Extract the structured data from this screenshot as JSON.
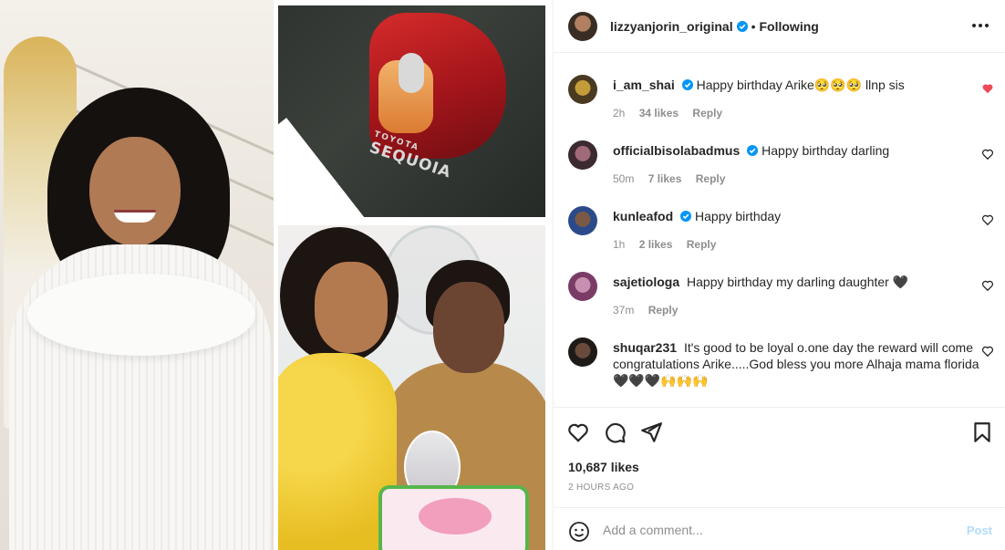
{
  "post": {
    "media_description": "collage-photo",
    "car_badge_brand": "TOYOTA",
    "car_badge_model": "SEQUOIA"
  },
  "header": {
    "username": "lizzyanjorin_original",
    "verified": true,
    "dot": "•",
    "follow_status": "Following",
    "more_icon": "more-horizontal-icon"
  },
  "comments": [
    {
      "username": "i_am_shai",
      "verified": true,
      "text": "Happy birthday Arike🥺🥺🥺 llnp sis",
      "time": "2h",
      "likes": "34 likes",
      "reply": "Reply",
      "liked": true
    },
    {
      "username": "officialbisolabadmus",
      "verified": true,
      "text": "Happy birthday darling",
      "time": "50m",
      "likes": "7 likes",
      "reply": "Reply",
      "liked": false
    },
    {
      "username": "kunleafod",
      "verified": true,
      "text": "Happy birthday",
      "time": "1h",
      "likes": "2 likes",
      "reply": "Reply",
      "liked": false
    },
    {
      "username": "sajetiologa",
      "verified": false,
      "text": "Happy birthday my darling daughter 🖤",
      "time": "37m",
      "likes": "",
      "reply": "Reply",
      "liked": false
    },
    {
      "username": "shuqar231",
      "verified": false,
      "text": "It's good to be loyal o.one day the reward will come congratulations Arike.....God bless you more Alhaja mama florida🖤🖤🖤🙌🙌🙌",
      "time": "",
      "likes": "",
      "reply": "",
      "liked": false
    }
  ],
  "actions": {
    "like_icon": "heart-icon",
    "comment_icon": "comment-icon",
    "share_icon": "send-icon",
    "save_icon": "bookmark-icon",
    "likes": "10,687 likes",
    "time_ago": "2 HOURS AGO"
  },
  "add_comment": {
    "placeholder": "Add a comment...",
    "post_label": "Post"
  },
  "colors": {
    "text": "#262626",
    "secondary": "#8e8e8e",
    "verified": "#0095f6",
    "liked_heart": "#ed4956",
    "post_disabled": "#b3dbff",
    "border": "#efefef"
  }
}
